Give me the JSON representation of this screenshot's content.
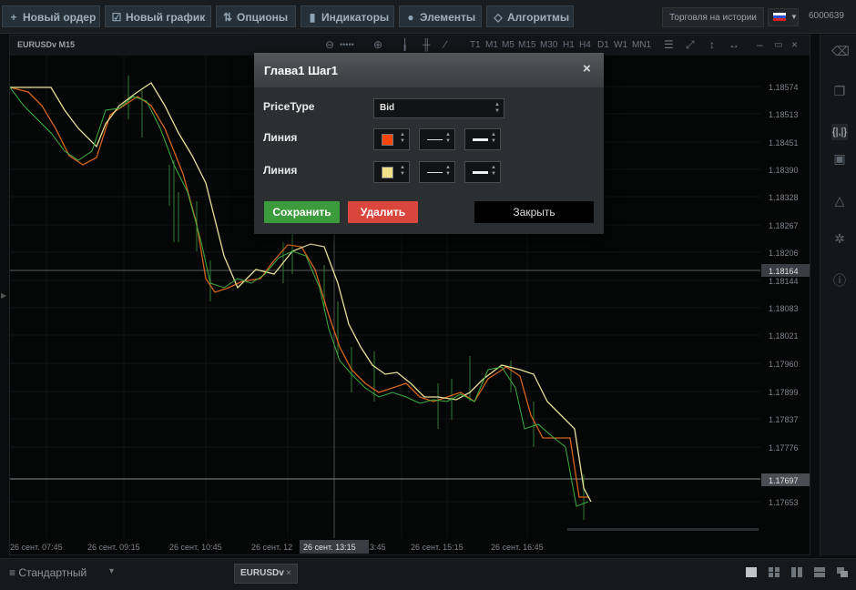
{
  "toolbar": {
    "new_order": "Новый ордер",
    "new_chart": "Новый график",
    "options": "Опционы",
    "indicators": "Индикаторы",
    "elements": "Элементы",
    "algorithms": "Алгоритмы",
    "history_trading": "Торговля на истории",
    "account": "6000639"
  },
  "chart": {
    "symbol_label": "EURUSDv M15",
    "timeframes": [
      "T1",
      "M1",
      "M5",
      "M15",
      "M30",
      "H1",
      "H4",
      "D1",
      "W1",
      "MN1"
    ],
    "price_ticks": [
      "1.18574",
      "1.18513",
      "1.18451",
      "1.18390",
      "1.18328",
      "1.18267",
      "1.18206",
      "1.18144",
      "1.18083",
      "1.18021",
      "1.17960",
      "1.17899",
      "1.17837",
      "1.17776",
      "1.17653"
    ],
    "price_badges": [
      "1.18164",
      "1.17697"
    ],
    "time_ticks": [
      "26 сент. 07:45",
      "26 сент. 09:15",
      "26 сент. 10:45",
      "26 сент. 12",
      "13:45",
      "26 сент. 15:15",
      "26 сент. 16:45"
    ],
    "crosshair_time": "26 сент. 13:15",
    "series_colors": {
      "green": "#3cb043",
      "orange": "#d4641e",
      "yellow": "#e8e09a"
    }
  },
  "modal": {
    "title": "Глава1 Шаг1",
    "close_glyph": "×",
    "price_type_label": "PriceType",
    "price_type_value": "Bid",
    "line1_label": "Линия",
    "line1_color": "#ff4500",
    "line2_label": "Линия",
    "line2_color": "#f0e08c",
    "save_label": "Сохранить",
    "delete_label": "Удалить",
    "close_label": "Закрыть",
    "save_color": "#3c9b3c",
    "delete_color": "#d9463c"
  },
  "bottom": {
    "layout_name": "Стандартный",
    "symbol_tab": "EURUSDv"
  }
}
